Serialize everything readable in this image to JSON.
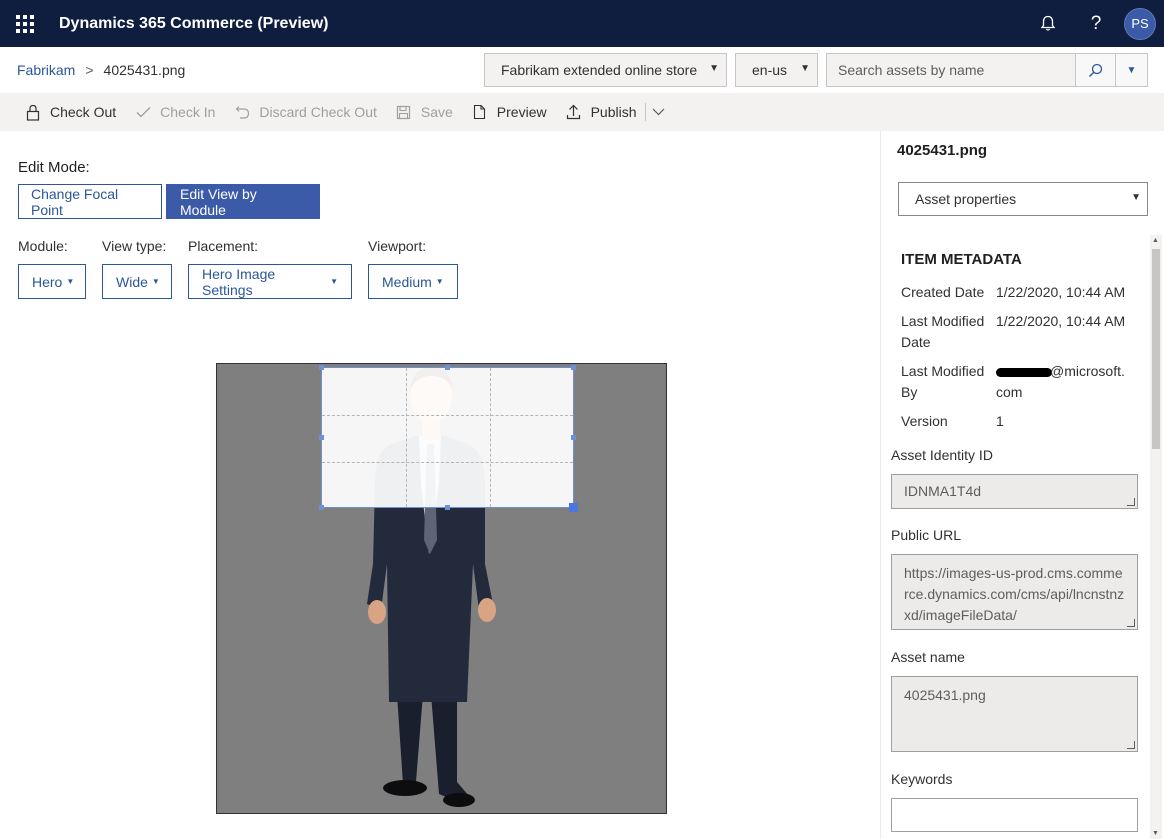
{
  "app": {
    "title": "Dynamics 365 Commerce (Preview)",
    "user_initials": "PS"
  },
  "breadcrumb": {
    "root": "Fabrikam",
    "separator": ">",
    "current": "4025431.png"
  },
  "site_select": {
    "value": "Fabrikam extended online store"
  },
  "locale_select": {
    "value": "en-us"
  },
  "search": {
    "placeholder": "Search assets by name"
  },
  "toolbar": {
    "check_out": "Check Out",
    "check_in": "Check In",
    "discard_check_out": "Discard Check Out",
    "save": "Save",
    "preview": "Preview",
    "publish": "Publish"
  },
  "edit": {
    "mode_label": "Edit Mode:",
    "change_focal_point": "Change Focal Point",
    "edit_view_by_module": "Edit View by Module",
    "module_label": "Module:",
    "module_value": "Hero",
    "view_type_label": "View type:",
    "view_type_value": "Wide",
    "placement_label": "Placement:",
    "placement_value": "Hero Image Settings",
    "viewport_label": "Viewport:",
    "viewport_value": "Medium"
  },
  "panel": {
    "title": "4025431.png",
    "properties_select": "Asset properties",
    "metadata_heading": "ITEM METADATA",
    "created_date_label": "Created Date",
    "created_date_value": "1/22/2020, 10:44 AM",
    "last_modified_date_label_1": "Last Modified",
    "last_modified_date_label_2": "Date",
    "last_modified_date_value": "1/22/2020, 10:44 AM",
    "last_modified_by_label_1": "Last Modified",
    "last_modified_by_label_2": "By",
    "last_modified_by_value_1": "@microsoft.",
    "last_modified_by_value_2": "com",
    "version_label": "Version",
    "version_value": "1",
    "asset_identity_label": "Asset Identity ID",
    "asset_identity_value": "IDNMA1T4d",
    "public_url_label": "Public URL",
    "public_url_value": "https://images-us-prod.cms.commerce.dynamics.com/cms/api/lncnstnzxd/imageFileData/",
    "asset_name_label": "Asset name",
    "asset_name_value": "4025431.png",
    "keywords_label": "Keywords",
    "keywords_value": ""
  },
  "colors": {
    "topbar": "#0f1d3f",
    "accent": "#3b5aa8",
    "link": "#2b579a",
    "canvas_bg": "#7f7f7f"
  }
}
